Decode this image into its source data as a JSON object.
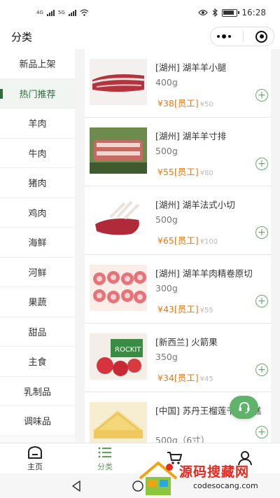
{
  "status_bar": {
    "network_left": "4G",
    "network_right": "5G",
    "time": "16:28"
  },
  "navbar": {
    "title": "分类"
  },
  "sidebar": {
    "items": [
      {
        "label": "新品上架",
        "active": false
      },
      {
        "label": "热门推荐",
        "active": true
      },
      {
        "label": "羊肉",
        "active": false
      },
      {
        "label": "牛肉",
        "active": false
      },
      {
        "label": "猪肉",
        "active": false
      },
      {
        "label": "鸡肉",
        "active": false
      },
      {
        "label": "海鲜",
        "active": false
      },
      {
        "label": "河鲜",
        "active": false
      },
      {
        "label": "果蔬",
        "active": false
      },
      {
        "label": "甜品",
        "active": false
      },
      {
        "label": "主食",
        "active": false
      },
      {
        "label": "乳制品",
        "active": false
      },
      {
        "label": "调味品",
        "active": false
      }
    ]
  },
  "products": [
    {
      "name": "[湖州] 湖羊羊小腿",
      "weight": "400g",
      "price": "¥38[员工]",
      "original_price": "¥50"
    },
    {
      "name": "[湖州] 湖羊羊寸排",
      "weight": "500g",
      "price": "¥55[员工]",
      "original_price": "¥80"
    },
    {
      "name": "[湖州] 湖羊法式小切",
      "weight": "500g",
      "price": "¥65[员工]",
      "original_price": "¥100"
    },
    {
      "name": "[湖州] 湖羊羊肉精卷原切",
      "weight": "300g",
      "price": "¥43[员工]",
      "original_price": "¥55"
    },
    {
      "name": "[新西兰] 火箭果",
      "weight": "350g",
      "price": "¥34[员工]",
      "original_price": "¥45"
    },
    {
      "name": "[中国] 苏丹王榴莲千层蛋糕",
      "weight": "500g（6寸）",
      "price": "",
      "original_price": ""
    }
  ],
  "tabbar": {
    "items": [
      {
        "label": "主页",
        "icon": "home-icon"
      },
      {
        "label": "分类",
        "icon": "category-list-icon"
      },
      {
        "label": "",
        "icon": "cart-icon"
      },
      {
        "label": "",
        "icon": "user-icon"
      }
    ]
  },
  "watermark": {
    "title": "源码搜藏网",
    "subtitle": "codesocang.com"
  },
  "colors": {
    "accent_green": "#5aa35f",
    "price_orange": "#e07b1f",
    "sidebar_active": "#2f6b3d"
  }
}
